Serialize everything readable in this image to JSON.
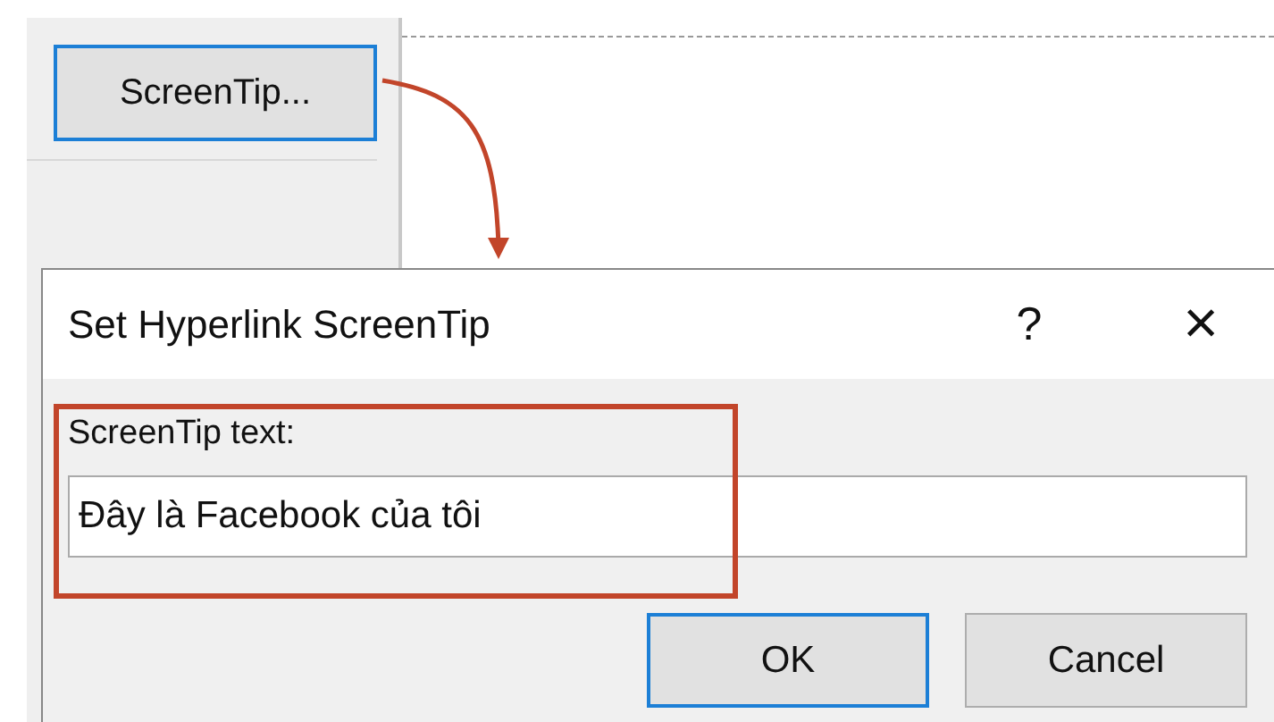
{
  "panel": {
    "button": {
      "label": "ScreenTip..."
    }
  },
  "dialog": {
    "title": "Set Hyperlink ScreenTip",
    "help": "?",
    "close": "×",
    "field": {
      "label": "ScreenTip text:",
      "value": "Đây là Facebook của tôi"
    },
    "buttons": [
      {
        "label": "OK",
        "default": true
      },
      {
        "label": "Cancel",
        "default": false
      }
    ]
  }
}
